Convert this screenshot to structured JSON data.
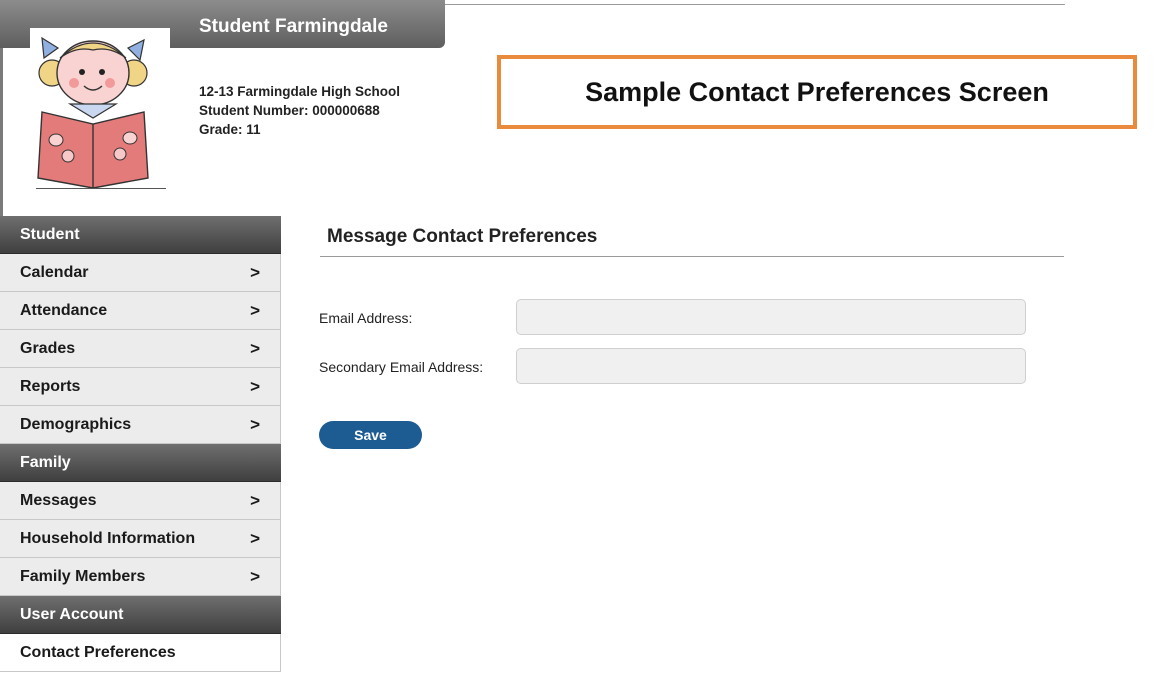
{
  "header": {
    "title": "Student Farmingdale"
  },
  "student": {
    "school": "12-13 Farmingdale High School",
    "number": "Student Number: 000000688",
    "grade": "Grade: 11"
  },
  "callout": {
    "text": "Sample Contact Preferences Screen",
    "border_color": "#e98a3c"
  },
  "sidebar": {
    "sections": [
      {
        "label": "Student",
        "items": [
          {
            "label": "Calendar",
            "chevron": ">"
          },
          {
            "label": "Attendance",
            "chevron": ">"
          },
          {
            "label": "Grades",
            "chevron": ">"
          },
          {
            "label": "Reports",
            "chevron": ">"
          },
          {
            "label": "Demographics",
            "chevron": ">"
          }
        ]
      },
      {
        "label": "Family",
        "items": [
          {
            "label": "Messages",
            "chevron": ">"
          },
          {
            "label": "Household Information",
            "chevron": ">"
          },
          {
            "label": "Family Members",
            "chevron": ">"
          }
        ]
      },
      {
        "label": "User Account",
        "items": [
          {
            "label": "Contact Preferences",
            "chevron": ""
          }
        ]
      }
    ]
  },
  "main": {
    "title": "Message Contact Preferences",
    "email_label": "Email Address:",
    "email_value": "",
    "secondary_email_label": "Secondary Email Address:",
    "secondary_email_value": "",
    "save_label": "Save",
    "save_color": "#1d5b93"
  }
}
